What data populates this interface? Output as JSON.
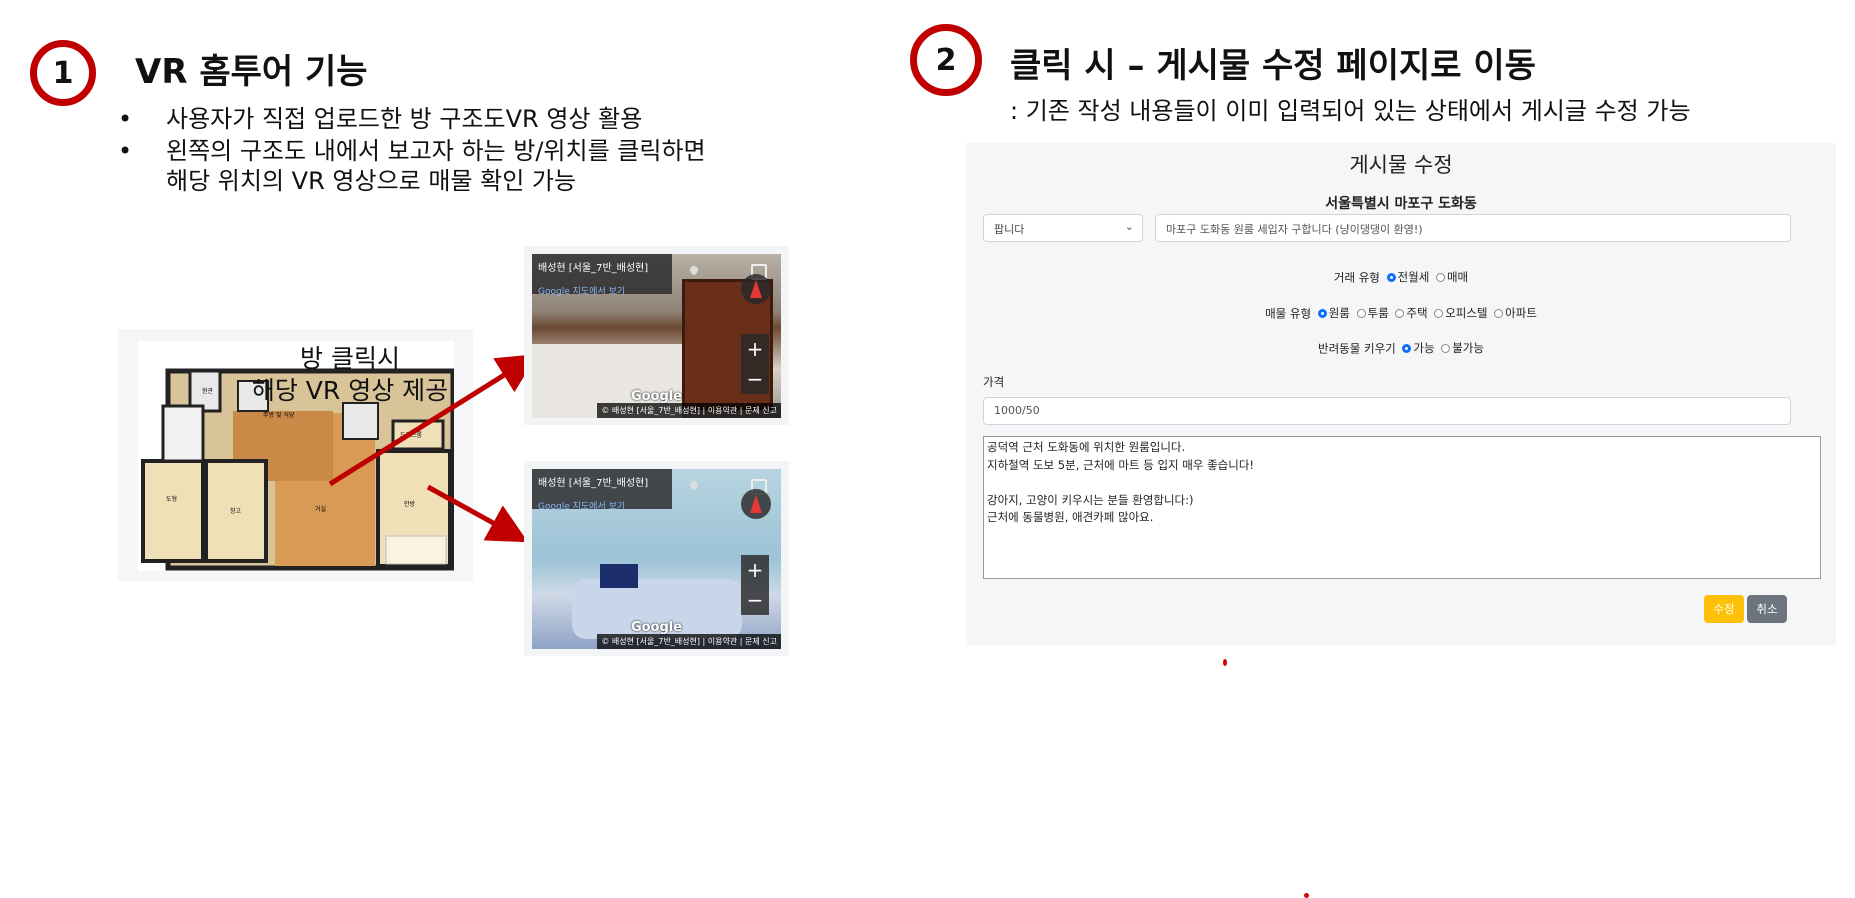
{
  "section1": {
    "number": "1",
    "title": "VR 홈투어 기능",
    "bullets": [
      [
        "사용자가 직접 업로드한 방 구조도VR 영상 활용"
      ],
      [
        "왼쪽의 구조도 내에서 보고자 하는 방/위치를 클릭하면",
        "해당 위치의 VR 영상으로 매물 확인 가능"
      ]
    ],
    "bullet_symbol": "•",
    "plan_caption": [
      "방 클릭시",
      "해당 VR 영상 제공"
    ],
    "plan_rooms": {
      "entry": "현관",
      "kitchen": "주방 및 식당",
      "dress": "드레스룸",
      "study": "도형",
      "storage": "창고",
      "living": "거실",
      "master": "안방"
    },
    "streetviews": [
      {
        "title": "배성현 [서울_7반_배성현]",
        "maps_link": "Google 지도에서 보기",
        "brand": "Google",
        "footer": "© 배성현 [서울_7반_배성현] | 이용약관 | 문제 신고"
      },
      {
        "title": "배성현 [서울_7반_배성현]",
        "maps_link": "Google 지도에서 보기",
        "brand": "Google",
        "footer": "© 배성현 [서울_7반_배성현] | 이용약관 | 문제 신고"
      }
    ]
  },
  "section2": {
    "number": "2",
    "title": "클릭 시 – 게시물 수정 페이지로 이동",
    "subtitle": ": 기존 작성 내용들이 이미 입력되어 있는 상태에서  게시글 수정 가능"
  },
  "form": {
    "title": "게시물 수정",
    "region": "서울특별시 마포구 도화동",
    "type_select": "팝니다",
    "post_title": "마포구 도화동 원룸 세입자 구합니다 (냥이댕댕이 환영!)",
    "deal_type": {
      "label": "거래 유형",
      "options": [
        "전월세",
        "매매"
      ],
      "selected": "전월세"
    },
    "property_type": {
      "label": "매물 유형",
      "options": [
        "원룸",
        "투룸",
        "주택",
        "오피스텔",
        "아파트"
      ],
      "selected": "원룸"
    },
    "pets": {
      "label": "반려동물 키우기",
      "options": [
        "가능",
        "불가능"
      ],
      "selected": "가능"
    },
    "price_label": "가격",
    "price_value": "1000/50",
    "content": "공덕역 근처 도화동에 위치한 원룸입니다.\n지하철역 도보 5분, 근처에 마트 등 입지 매우 좋습니다!\n\n강아지, 고양이 키우시는 분들 환영합니다:)\n근처에 동물병원, 애견카페 많아요.",
    "submit_label": "수정",
    "cancel_label": "취소"
  },
  "colors": {
    "accent_red": "#c00000",
    "arrow_red": "#c00000",
    "btn_warning": "#ffc107",
    "btn_secondary": "#6c757d",
    "radio_blue": "#0d6efd"
  }
}
